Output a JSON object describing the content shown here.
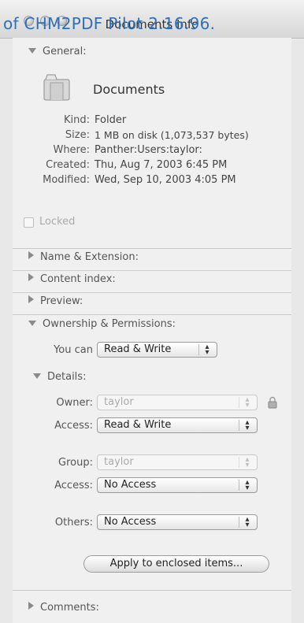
{
  "window": {
    "title": "Documents Info",
    "banner": "of CHM2PDF Pilot 2.16.96."
  },
  "general": {
    "label": "General:",
    "name": "Documents",
    "fields": [
      {
        "label": "Kind:",
        "value": "Folder"
      },
      {
        "label": "Size:",
        "value": "1 MB on disk (1,073,537 bytes)"
      },
      {
        "label": "Where:",
        "value": "Panther:Users:taylor:"
      },
      {
        "label": "Created:",
        "value": "Thu, Aug 7, 2003 6:45 PM"
      },
      {
        "label": "Modified:",
        "value": "Wed, Sep 10, 2003 4:05 PM"
      }
    ],
    "locked_label": "Locked",
    "locked_checked": false
  },
  "sections": [
    "Name & Extension:",
    "Content index:",
    "Preview:"
  ],
  "ownership": {
    "label": "Ownership & Permissions:",
    "you_can": {
      "label": "You can",
      "value": "Read & Write"
    },
    "details_label": "Details:",
    "owner": {
      "label": "Owner:",
      "value": "taylor",
      "enabled": false
    },
    "owner_access": {
      "label": "Access:",
      "value": "Read & Write"
    },
    "group": {
      "label": "Group:",
      "value": "taylor",
      "enabled": false
    },
    "group_access": {
      "label": "Access:",
      "value": "No Access"
    },
    "others": {
      "label": "Others:",
      "value": "No Access"
    },
    "apply_button": "Apply to enclosed items..."
  },
  "comments": {
    "label": "Comments:"
  },
  "icons": [
    "folder-icon",
    "lock-icon",
    "disclosure-down-icon",
    "disclosure-right-icon"
  ]
}
